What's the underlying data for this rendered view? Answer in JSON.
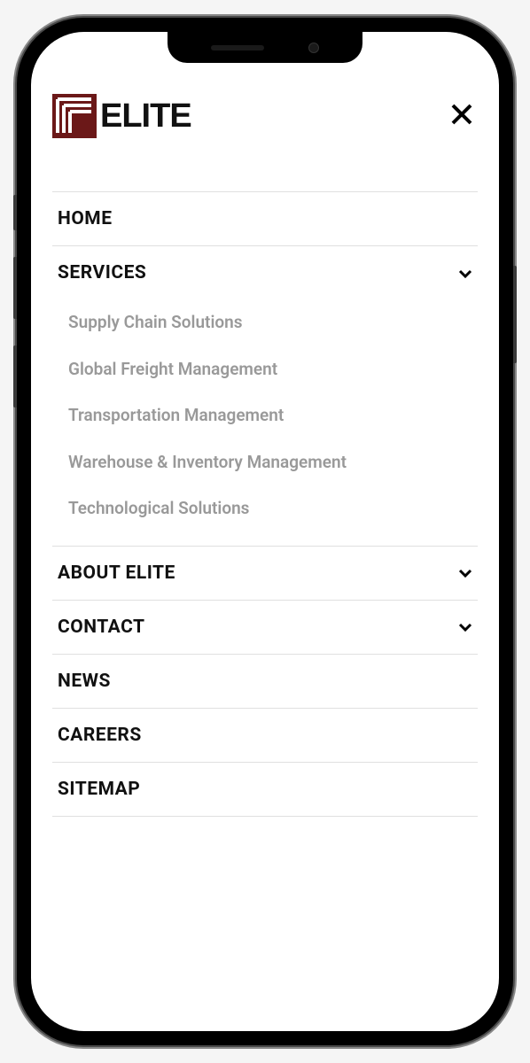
{
  "logo": {
    "text": "ELITE"
  },
  "nav": {
    "items": [
      {
        "label": "HOME",
        "hasSubmenu": false,
        "expanded": false
      },
      {
        "label": "SERVICES",
        "hasSubmenu": true,
        "expanded": true,
        "submenu": [
          "Supply Chain Solutions",
          "Global Freight Management",
          "Transportation Management",
          "Warehouse & Inventory Management",
          "Technological Solutions"
        ]
      },
      {
        "label": "ABOUT ELITE",
        "hasSubmenu": true,
        "expanded": false
      },
      {
        "label": "CONTACT",
        "hasSubmenu": true,
        "expanded": false
      },
      {
        "label": "NEWS",
        "hasSubmenu": false,
        "expanded": false
      },
      {
        "label": "CAREERS",
        "hasSubmenu": false,
        "expanded": false
      },
      {
        "label": "SITEMAP",
        "hasSubmenu": false,
        "expanded": false
      }
    ]
  }
}
